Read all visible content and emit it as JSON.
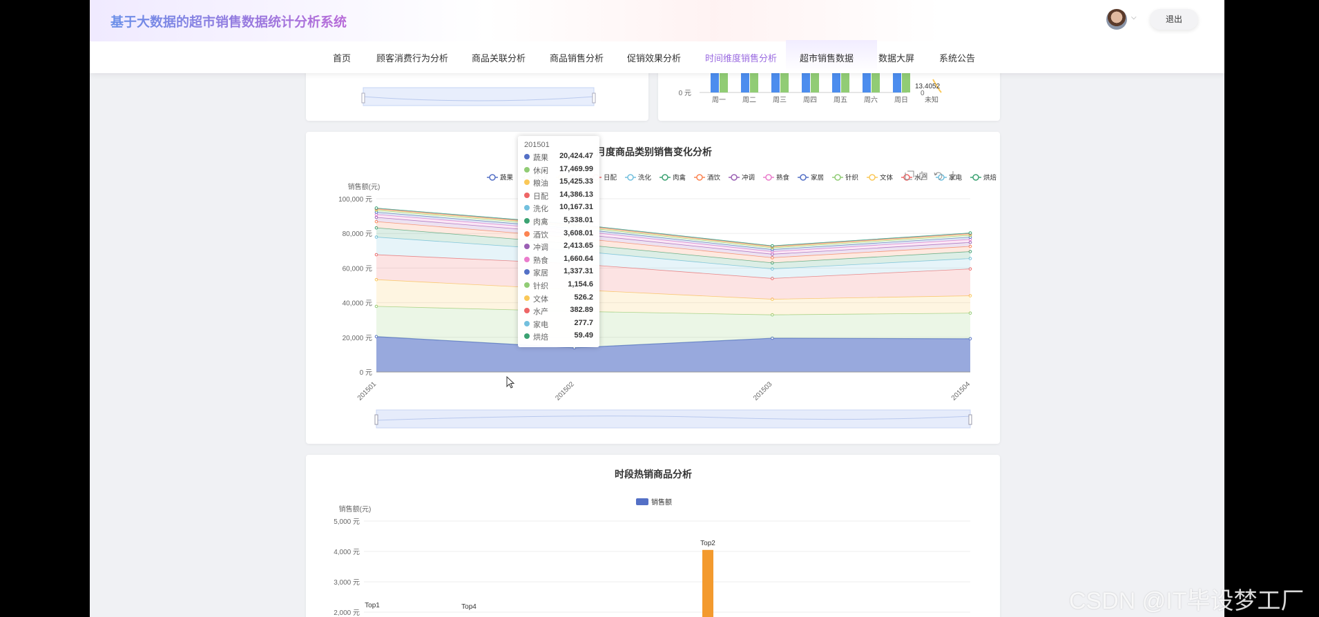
{
  "app": {
    "title": "基于大数据的超市销售数据统计分析系统",
    "logout_label": "退出",
    "nav": [
      "首页",
      "顾客消费行为分析",
      "商品关联分析",
      "商品销售分析",
      "促销效果分析",
      "时间维度销售分析",
      "超市销售数据",
      "数据大屏",
      "系统公告"
    ],
    "active_nav": "时间维度销售分析",
    "accent_color": "#9a6ae0"
  },
  "weekday_chart": {
    "categories": [
      "周一",
      "周二",
      "周三",
      "周四",
      "周五",
      "周六",
      "周日",
      "未知"
    ],
    "y_label_visible": "0 元",
    "right_axis_label": "0",
    "point_label": "13.4052",
    "series_colors": [
      "#4c8dee",
      "#91cc75"
    ]
  },
  "monthly_chart": {
    "title": "月度商品类别销售变化分析",
    "ylabel": "销售额(元)",
    "y_ticks": [
      "0 元",
      "20,000 元",
      "40,000 元",
      "60,000 元",
      "80,000 元",
      "100,000 元"
    ],
    "legend": [
      "蔬果",
      "休闲",
      "粮油",
      "日配",
      "洗化",
      "肉禽",
      "酒饮",
      "冲调",
      "熟食",
      "家居",
      "针织",
      "文体",
      "水产",
      "家电",
      "烘焙"
    ],
    "toolbox": [
      "zoom-icon",
      "zoom-reset-icon",
      "restore-icon",
      "download-icon"
    ]
  },
  "hot_goods_chart": {
    "title": "时段热销商品分析",
    "legend": "销售额",
    "ylabel": "销售额(元)",
    "y_ticks": [
      "2,000 元",
      "3,000 元",
      "4,000 元",
      "5,000 元"
    ],
    "bar_labels": [
      "Top1",
      "Top4",
      "Top2"
    ]
  },
  "tooltip": {
    "title": "201501",
    "rows": [
      {
        "name": "蔬果",
        "value": "20,424.47",
        "color": "#5470c6"
      },
      {
        "name": "休闲",
        "value": "17,469.99",
        "color": "#91cc75"
      },
      {
        "name": "粮油",
        "value": "15,425.33",
        "color": "#fac858"
      },
      {
        "name": "日配",
        "value": "14,386.13",
        "color": "#ee6666"
      },
      {
        "name": "洗化",
        "value": "10,167.31",
        "color": "#73c0de"
      },
      {
        "name": "肉禽",
        "value": "5,338.01",
        "color": "#3ba272"
      },
      {
        "name": "酒饮",
        "value": "3,608.01",
        "color": "#fc8452"
      },
      {
        "name": "冲调",
        "value": "2,413.65",
        "color": "#9a60b4"
      },
      {
        "name": "熟食",
        "value": "1,660.64",
        "color": "#ea7ccc"
      },
      {
        "name": "家居",
        "value": "1,337.31",
        "color": "#5470c6"
      },
      {
        "name": "针织",
        "value": "1,154.6",
        "color": "#91cc75"
      },
      {
        "name": "文体",
        "value": "526.2",
        "color": "#fac858"
      },
      {
        "name": "水产",
        "value": "382.89",
        "color": "#ee6666"
      },
      {
        "name": "家电",
        "value": "277.7",
        "color": "#73c0de"
      },
      {
        "name": "烘焙",
        "value": "59.49",
        "color": "#3ba272"
      }
    ]
  },
  "chart_data": [
    {
      "type": "area",
      "title": "月度商品类别销售变化分析",
      "ylabel": "销售额(元)",
      "ylim": [
        0,
        100000
      ],
      "stacked": true,
      "legend_position": "top",
      "x": [
        "201501",
        "201502",
        "201503",
        "201504"
      ],
      "series": [
        {
          "name": "蔬果",
          "values": [
            20424,
            14000,
            19500,
            19200
          ]
        },
        {
          "name": "休闲",
          "values": [
            17470,
            21000,
            13500,
            14800
          ]
        },
        {
          "name": "粮油",
          "values": [
            15425,
            12500,
            9000,
            10000
          ]
        },
        {
          "name": "日配",
          "values": [
            14386,
            15000,
            12000,
            15500
          ]
        },
        {
          "name": "洗化",
          "values": [
            10167,
            7500,
            5500,
            6000
          ]
        },
        {
          "name": "肉禽",
          "values": [
            5338,
            4000,
            3500,
            4000
          ]
        },
        {
          "name": "酒饮",
          "values": [
            3608,
            3500,
            3000,
            3000
          ]
        },
        {
          "name": "冲调",
          "values": [
            2414,
            2400,
            2000,
            2300
          ]
        },
        {
          "name": "熟食",
          "values": [
            1661,
            1700,
            1500,
            1700
          ]
        },
        {
          "name": "家居",
          "values": [
            1337,
            1300,
            1200,
            1300
          ]
        },
        {
          "name": "针织",
          "values": [
            1155,
            1100,
            1000,
            1100
          ]
        },
        {
          "name": "文体",
          "values": [
            526,
            600,
            500,
            600
          ]
        },
        {
          "name": "水产",
          "values": [
            383,
            400,
            350,
            400
          ]
        },
        {
          "name": "家电",
          "values": [
            278,
            300,
            250,
            300
          ]
        },
        {
          "name": "烘焙",
          "values": [
            59,
            60,
            60,
            60
          ]
        }
      ]
    },
    {
      "type": "bar",
      "title": "时段热销商品分析",
      "ylabel": "销售额(元)",
      "legend": "销售额",
      "categories": [
        "Top1",
        "Top4",
        "Top2"
      ],
      "values": [
        2000,
        1950,
        4050
      ],
      "ylim": [
        0,
        5000
      ]
    }
  ]
}
